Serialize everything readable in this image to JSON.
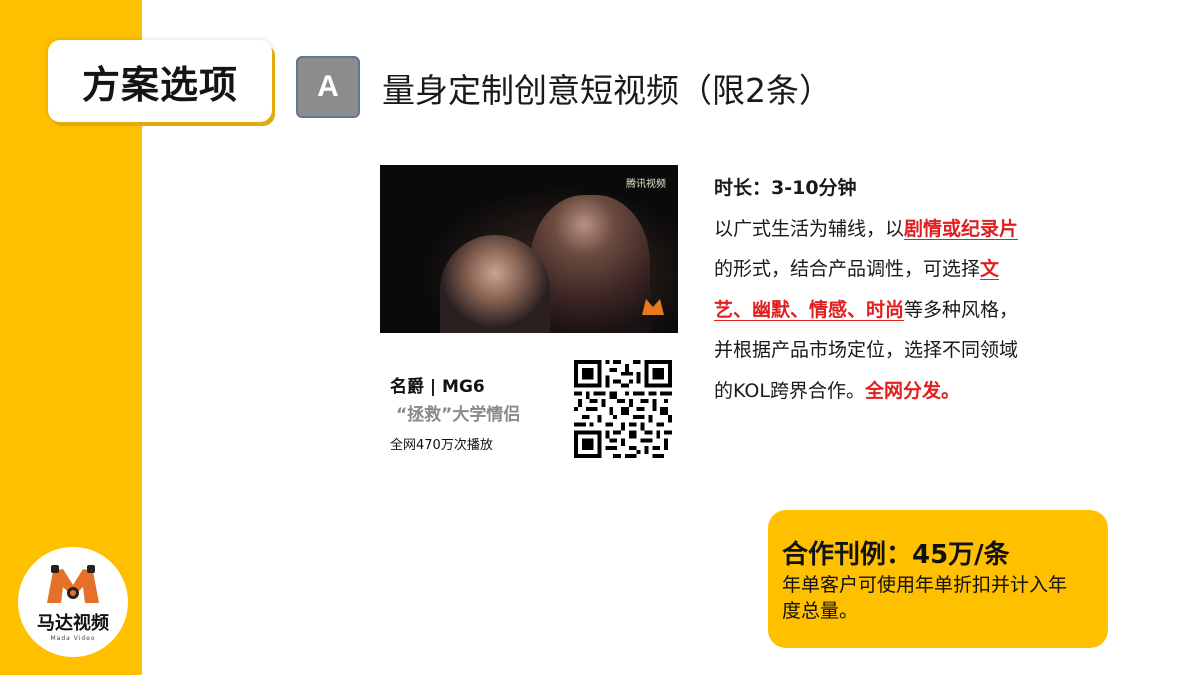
{
  "section_tag": "方案选项",
  "option_letter": "A",
  "headline": "量身定制创意短视频（限2条）",
  "video": {
    "watermark": "腾讯视频",
    "corner_logo": "马达视频"
  },
  "case": {
    "title": "名爵 | MG6",
    "subtitle": "“拯救”大学情侣",
    "views": "全网470万次播放"
  },
  "description": {
    "duration": "时长：3-10分钟",
    "p1": "以广式生活为辅线，以",
    "h1": "剧情或纪录片",
    "p2": "的形式，结合产品调性，可选择",
    "h2": "文艺、幽默、情感、时尚",
    "p3": "等多种风格，并根据产品市场定位，选择不同领域的KOL跨界合作。",
    "red_tail": "全网分发。"
  },
  "pricing": {
    "title": "合作刊例：45万/条",
    "note": "年单客户可使用年单折扣并计入年度总量。"
  },
  "brand": {
    "name": "马达视频",
    "name_en": "Mada Video"
  },
  "colors": {
    "accent": "#ffc000",
    "highlight_red": "#e02020",
    "badge_gray": "#8c8c8c"
  }
}
